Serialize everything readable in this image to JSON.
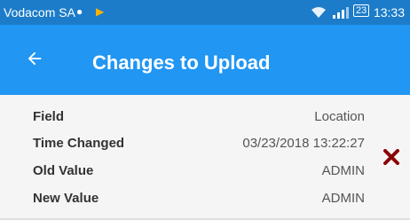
{
  "status_bar": {
    "carrier": "Vodacom SA",
    "notification_icons": [
      "chat-bubble-icon",
      "play-store-icon"
    ],
    "system_icons": [
      "wifi-icon",
      "signal-icon",
      "battery-icon"
    ],
    "battery": "23",
    "time": "13:33"
  },
  "app_bar": {
    "title": "Changes to Upload",
    "back_icon": "arrow-left-icon"
  },
  "change_record": {
    "rows": [
      {
        "label": "Field",
        "value": "Location"
      },
      {
        "label": "Time Changed",
        "value": "03/23/2018 13:22:27"
      },
      {
        "label": "Old Value",
        "value": "ADMIN"
      },
      {
        "label": "New Value",
        "value": "ADMIN"
      }
    ],
    "delete_icon": "close-x-icon",
    "delete_color": "#8b0000"
  },
  "colors": {
    "status_bar": "#1c7cc9",
    "app_bar": "#2196f3",
    "card_background": "#f5f5f5"
  }
}
